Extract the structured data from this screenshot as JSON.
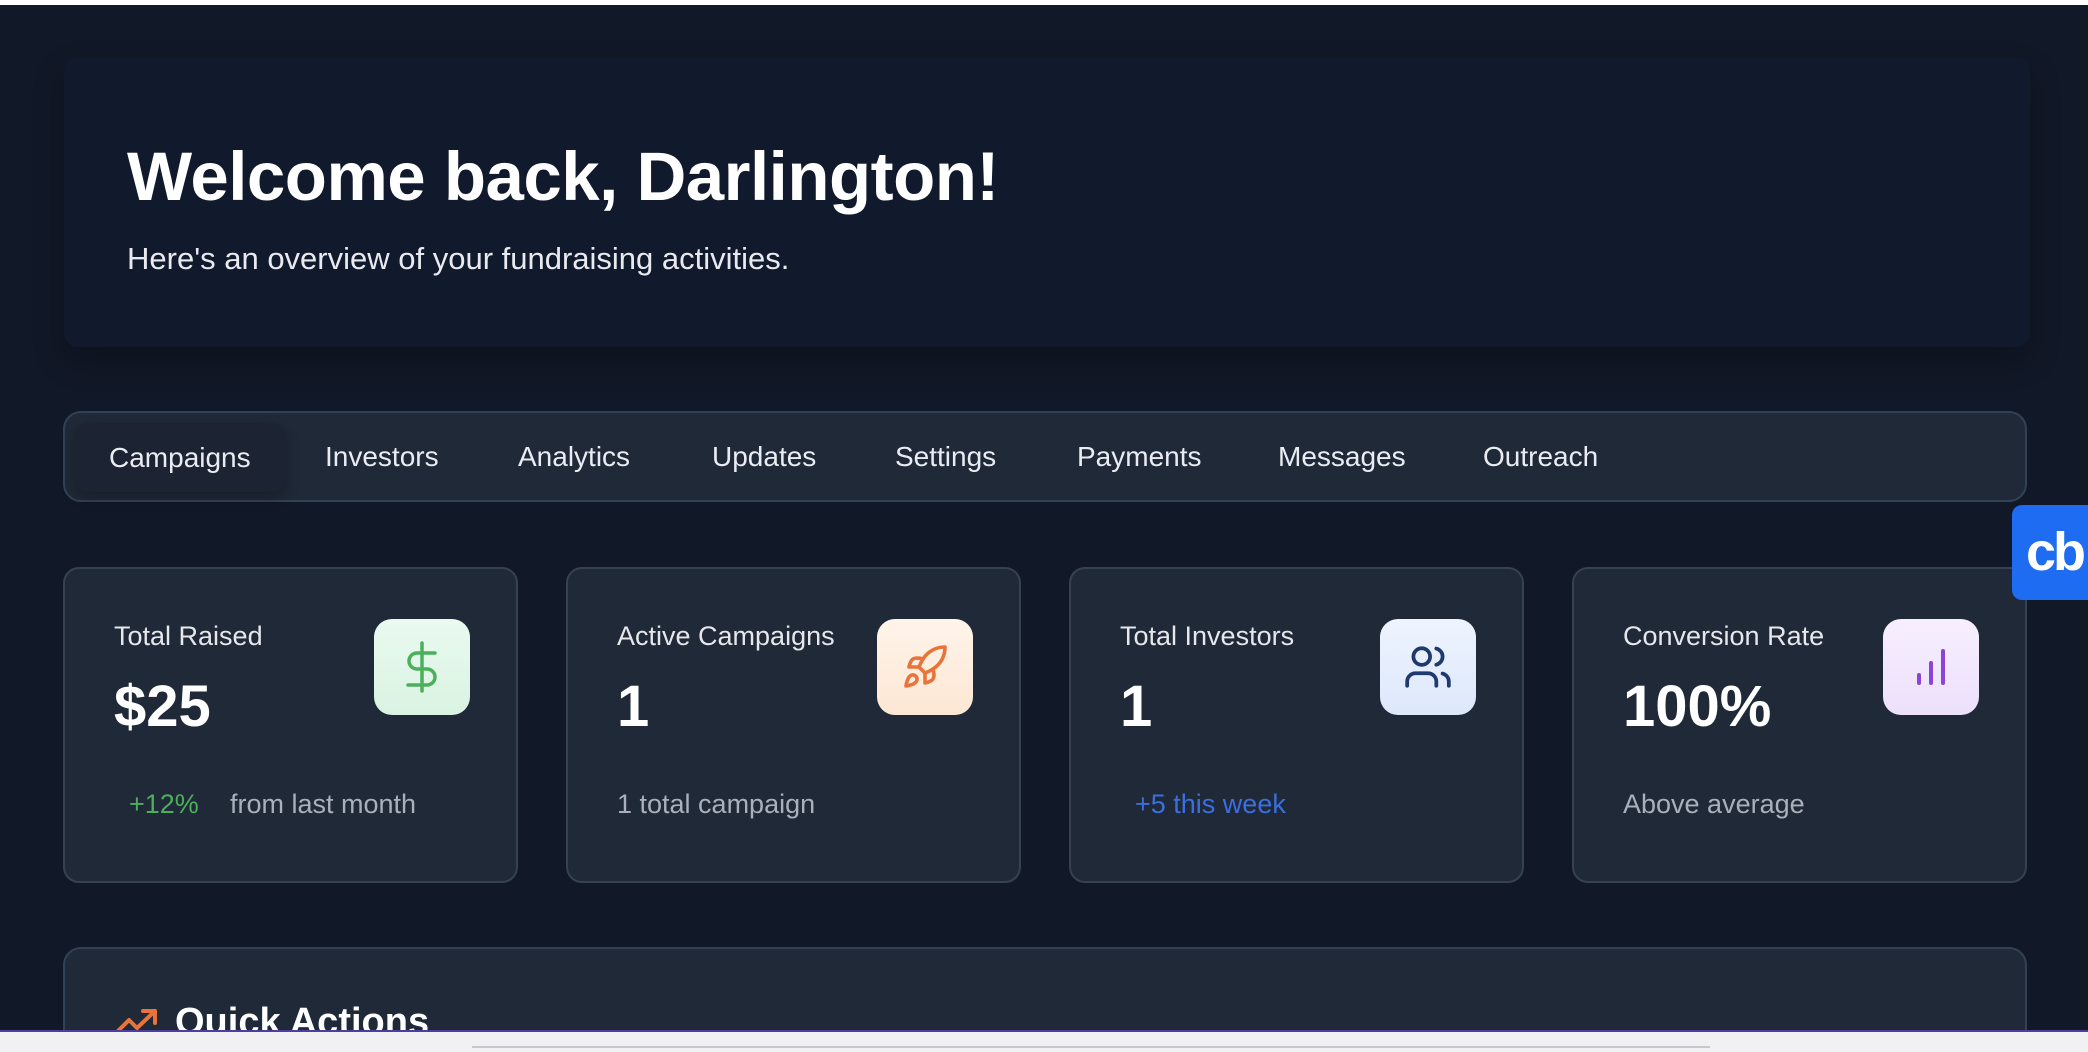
{
  "header": {
    "title": "Welcome back, Darlington!",
    "subtitle": "Here's an overview of your fundraising activities."
  },
  "tabs": [
    {
      "label": "Campaigns",
      "active": true
    },
    {
      "label": "Investors"
    },
    {
      "label": "Analytics"
    },
    {
      "label": "Updates"
    },
    {
      "label": "Settings"
    },
    {
      "label": "Payments"
    },
    {
      "label": "Messages"
    },
    {
      "label": "Outreach"
    }
  ],
  "stats": [
    {
      "label": "Total Raised",
      "value": "$25",
      "change": "+12%",
      "change_note": "from last month",
      "icon": "dollar-icon",
      "accent": "#4caf5a"
    },
    {
      "label": "Active Campaigns",
      "value": "1",
      "note": "1 total campaign",
      "icon": "rocket-icon",
      "accent": "#e8743b"
    },
    {
      "label": "Total Investors",
      "value": "1",
      "note": "+5 this week",
      "icon": "users-icon",
      "accent": "#1e3a6e"
    },
    {
      "label": "Conversion Rate",
      "value": "100%",
      "note": "Above average",
      "icon": "bar-chart-icon",
      "accent": "#8b45d6"
    }
  ],
  "quick_actions": {
    "title": "Quick Actions",
    "icon": "trending-up-icon",
    "accent": "#e8743b"
  },
  "floating_widget": {
    "label": "cb",
    "color": "#1d6cf2"
  }
}
